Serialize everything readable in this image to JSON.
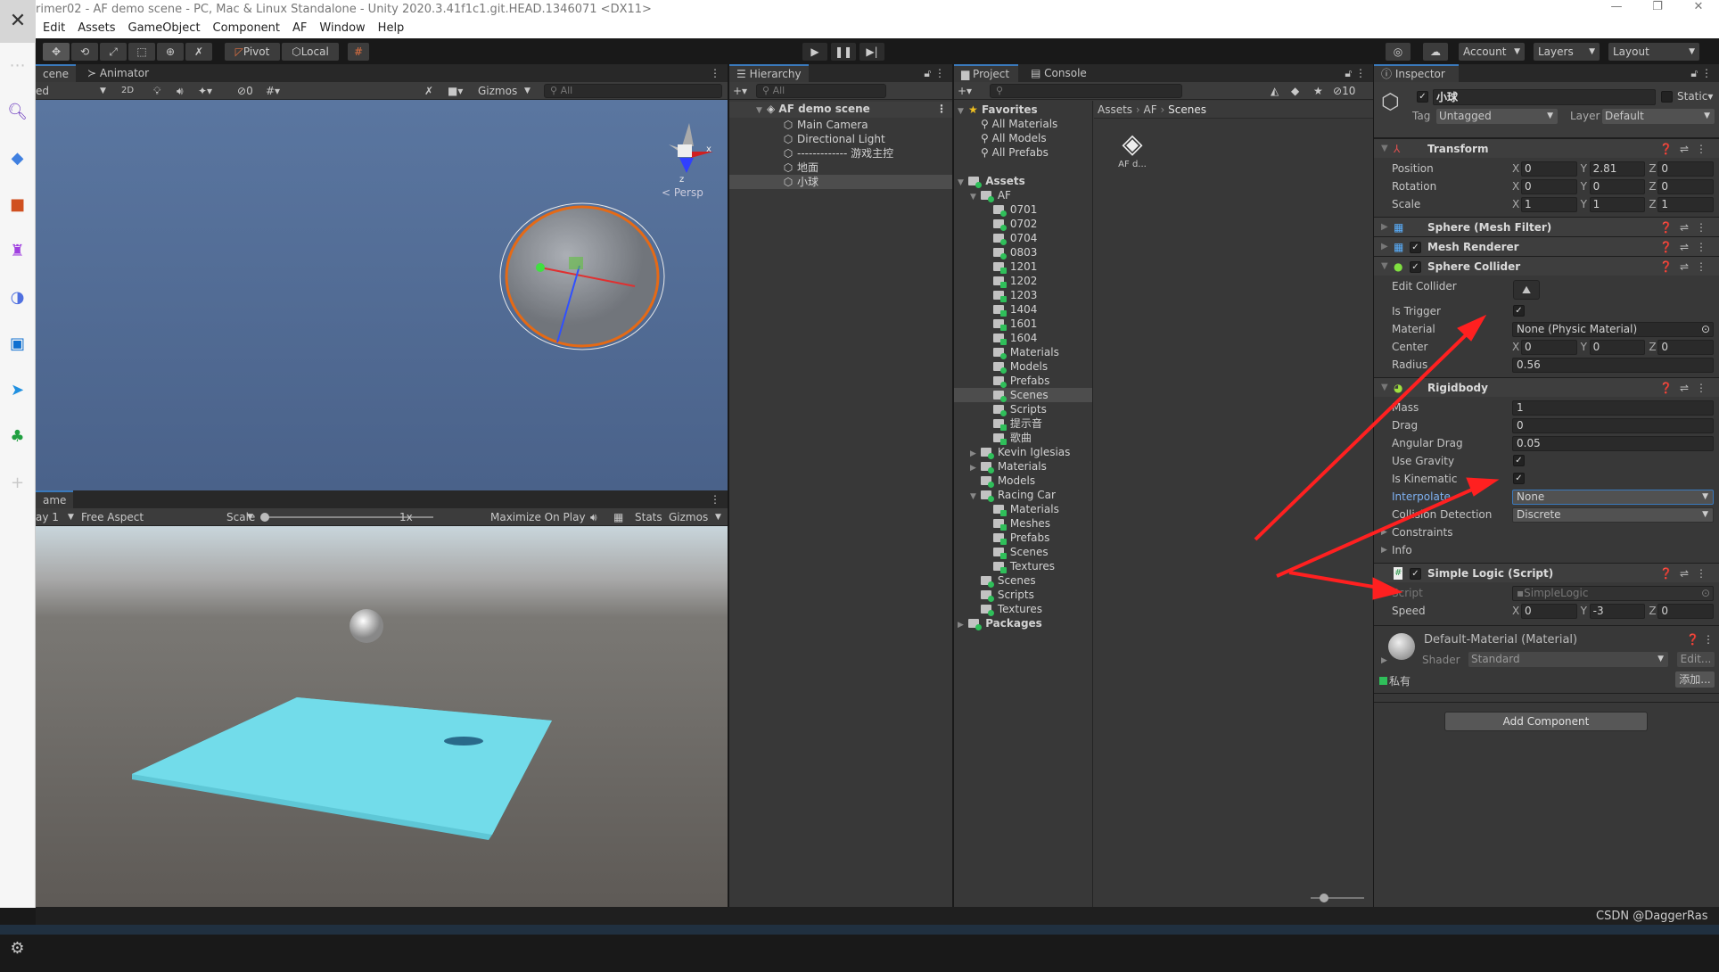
{
  "window": {
    "title": "rimer02 - AF demo scene - PC, Mac & Linux Standalone - Unity 2020.3.41f1c1.git.HEAD.1346071 <DX11>",
    "controls": [
      "—",
      "❐",
      "✕"
    ]
  },
  "menu": [
    "Edit",
    "Assets",
    "GameObject",
    "Component",
    "AF",
    "Window",
    "Help"
  ],
  "toolbar": {
    "pivot": "Pivot",
    "local": "Local",
    "account": "Account",
    "layers": "Layers",
    "layout": "Layout"
  },
  "scene": {
    "tabs": [
      "cene",
      "Animator"
    ],
    "shading": "ed",
    "mode_2d": "2D",
    "hidden_count": "0",
    "gizmos": "Gizmos",
    "search_placeholder": "All",
    "persp": "< Persp"
  },
  "game": {
    "tab": "ame",
    "display": "ay 1",
    "aspect": "Free Aspect",
    "scale_label": "Scale",
    "scale_value": "1x",
    "maximize": "Maximize On Play",
    "stats": "Stats",
    "gizmos": "Gizmos"
  },
  "hierarchy": {
    "tab": "Hierarchy",
    "search_placeholder": "All",
    "scene": "AF demo scene",
    "items": [
      "Main Camera",
      "Directional Light",
      "------------- 游戏主控",
      "地面",
      "小球"
    ],
    "selected": "小球"
  },
  "project": {
    "tabs": [
      "Project",
      "Console"
    ],
    "hidden_count": "10",
    "breadcrumb": [
      "Assets",
      "AF",
      "Scenes"
    ],
    "asset": "AF d...",
    "favorites": {
      "label": "Favorites",
      "items": [
        "All Materials",
        "All Models",
        "All Prefabs"
      ]
    },
    "tree": [
      {
        "label": "Assets",
        "level": 0,
        "open": true,
        "bold": true
      },
      {
        "label": "AF",
        "level": 1,
        "open": true
      },
      {
        "label": "0701",
        "level": 2
      },
      {
        "label": "0702",
        "level": 2
      },
      {
        "label": "0704",
        "level": 2
      },
      {
        "label": "0803",
        "level": 2
      },
      {
        "label": "1201",
        "level": 2
      },
      {
        "label": "1202",
        "level": 2
      },
      {
        "label": "1203",
        "level": 2
      },
      {
        "label": "1404",
        "level": 2
      },
      {
        "label": "1601",
        "level": 2
      },
      {
        "label": "1604",
        "level": 2
      },
      {
        "label": "Materials",
        "level": 2
      },
      {
        "label": "Models",
        "level": 2
      },
      {
        "label": "Prefabs",
        "level": 2
      },
      {
        "label": "Scenes",
        "level": 2,
        "selected": true
      },
      {
        "label": "Scripts",
        "level": 2
      },
      {
        "label": "提示音",
        "level": 2
      },
      {
        "label": "歌曲",
        "level": 2
      },
      {
        "label": "Kevin Iglesias",
        "level": 1,
        "closed": true
      },
      {
        "label": "Materials",
        "level": 1,
        "closed": true
      },
      {
        "label": "Models",
        "level": 1
      },
      {
        "label": "Racing Car",
        "level": 1,
        "open": true
      },
      {
        "label": "Materials",
        "level": 2
      },
      {
        "label": "Meshes",
        "level": 2
      },
      {
        "label": "Prefabs",
        "level": 2
      },
      {
        "label": "Scenes",
        "level": 2
      },
      {
        "label": "Textures",
        "level": 2
      },
      {
        "label": "Scenes",
        "level": 1
      },
      {
        "label": "Scripts",
        "level": 1
      },
      {
        "label": "Textures",
        "level": 1
      },
      {
        "label": "Packages",
        "level": 0,
        "closed": true,
        "bold": true
      }
    ]
  },
  "inspector": {
    "tab": "Inspector",
    "object_name": "小球",
    "static": "Static",
    "tag_label": "Tag",
    "tag": "Untagged",
    "layer_label": "Layer",
    "layer": "Default",
    "transform": {
      "title": "Transform",
      "rows": [
        {
          "label": "Position",
          "x": "0",
          "y": "2.81",
          "z": "0"
        },
        {
          "label": "Rotation",
          "x": "0",
          "y": "0",
          "z": "0"
        },
        {
          "label": "Scale",
          "x": "1",
          "y": "1",
          "z": "1"
        }
      ]
    },
    "mesh_filter": "Sphere (Mesh Filter)",
    "mesh_renderer": "Mesh Renderer",
    "sphere_collider": {
      "title": "Sphere Collider",
      "edit_collider": "Edit Collider",
      "is_trigger": "Is Trigger",
      "is_trigger_value": true,
      "material_label": "Material",
      "material": "None (Physic Material)",
      "center_label": "Center",
      "center": {
        "x": "0",
        "y": "0",
        "z": "0"
      },
      "radius_label": "Radius",
      "radius": "0.56"
    },
    "rigidbody": {
      "title": "Rigidbody",
      "mass_label": "Mass",
      "mass": "1",
      "drag_label": "Drag",
      "drag": "0",
      "angular_label": "Angular Drag",
      "angular": "0.05",
      "gravity_label": "Use Gravity",
      "gravity": true,
      "kinematic_label": "Is Kinematic",
      "kinematic": true,
      "interpolate_label": "Interpolate",
      "interpolate": "None",
      "collision_label": "Collision Detection",
      "collision": "Discrete",
      "constraints": "Constraints",
      "info": "Info"
    },
    "script": {
      "title": "Simple Logic (Script)",
      "script_label": "Script",
      "script": "SimpleLogic",
      "speed_label": "Speed",
      "speed": {
        "x": "0",
        "y": "-3",
        "z": "0"
      }
    },
    "material": {
      "title": "Default-Material (Material)",
      "shader_label": "Shader",
      "shader": "Standard",
      "edit": "Edit...",
      "private": "私有",
      "add": "添加..."
    },
    "add_component": "Add Component"
  },
  "status": {
    "watermark": "CSDN @DaggerRas"
  },
  "colors": {
    "accent": "#3a79bb",
    "annotation_arrow": "#ff2020",
    "plane": "#6ed6e6",
    "selection_outline": "#ff6a00"
  }
}
